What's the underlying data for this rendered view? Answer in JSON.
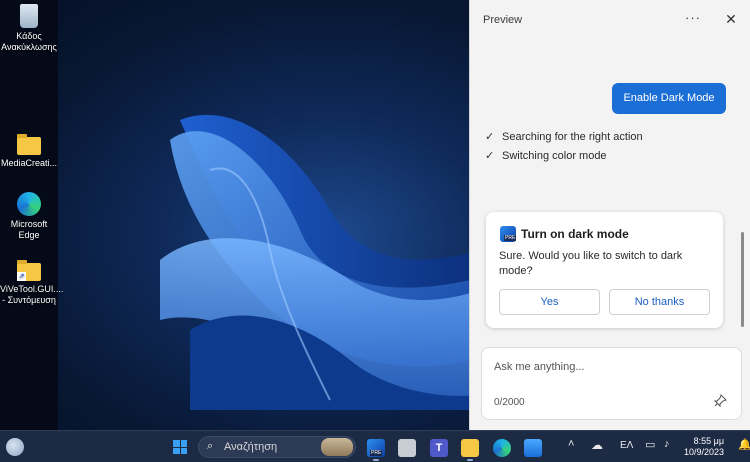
{
  "desktop": {
    "icons": [
      {
        "label": "Κάδος Ανακύκλωσης",
        "icon": "recycle-bin-icon"
      },
      {
        "label": "MediaCreati...",
        "icon": "folder-icon"
      },
      {
        "label": "Microsoft Edge",
        "icon": "edge-icon"
      },
      {
        "label": "ViVeTool.GUI.... - Συντόμευση",
        "icon": "folder-shortcut-icon"
      }
    ]
  },
  "panel": {
    "title": "Preview",
    "more_label": "···",
    "close_label": "✕",
    "enable_button": "Enable Dark Mode",
    "steps": [
      "Searching for the right action",
      "Switching color mode"
    ],
    "card": {
      "title": "Turn on dark mode",
      "body": "Sure. Would you like to switch to dark mode?",
      "yes": "Yes",
      "no": "No thanks",
      "badge": "PRE"
    },
    "input": {
      "placeholder": "Ask me anything...",
      "count": "0/2000"
    }
  },
  "taskbar": {
    "search_placeholder": "Αναζήτηση",
    "language": "ΕΛ",
    "time": "8:55 μμ",
    "date": "10/9/2023"
  },
  "colors": {
    "accent": "#1a6ed6",
    "panel_bg": "#f3f3f3",
    "taskbar_bg": "#1c2a44"
  }
}
